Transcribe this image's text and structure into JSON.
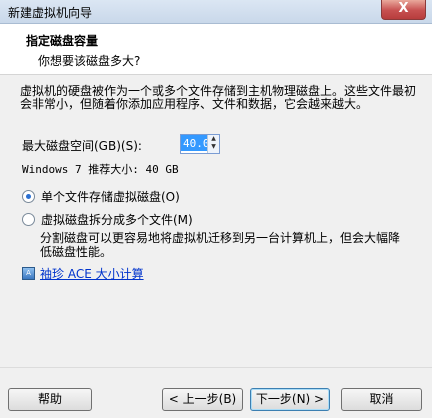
{
  "window": {
    "title": "新建虚拟机向导",
    "close_label": "X"
  },
  "header": {
    "title": "指定磁盘容量",
    "subtitle": "你想要该磁盘多大?"
  },
  "description": "虚拟机的硬盘被作为一个或多个文件存储到主机物理磁盘上。这些文件最初会非常小，但随着你添加应用程序、文件和数据，它会越来越大。",
  "disk": {
    "max_size_label": "最大磁盘空间(GB)(S):",
    "max_size_value": "40.0",
    "recommended_text": "Windows 7 推荐大小: 40 GB"
  },
  "options": {
    "single_file": {
      "label": "单个文件存储虚拟磁盘(O)",
      "checked": true
    },
    "split_files": {
      "label": "虚拟磁盘拆分成多个文件(M)",
      "checked": false
    },
    "split_hint": "分割磁盘可以更容易地将虚拟机迁移到另一台计算机上，但会大幅降低磁盘性能。"
  },
  "link": {
    "label": "袖珍 ACE 大小计算"
  },
  "buttons": {
    "help": "帮助",
    "back": "< 上一步(B)",
    "next": "下一步(N) >",
    "cancel": "取消"
  }
}
